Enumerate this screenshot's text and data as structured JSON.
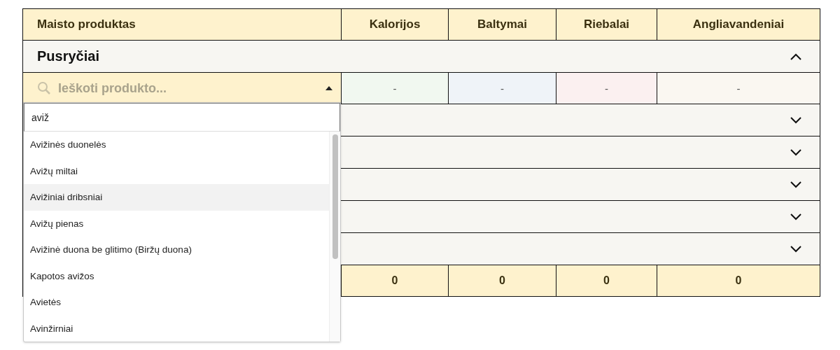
{
  "table": {
    "columns": [
      "Maisto produktas",
      "Kalorijos",
      "Baltymai",
      "Riebalai",
      "Angliavandeniai"
    ],
    "sections": [
      {
        "title": "Pusryčiai",
        "expanded": true,
        "search": {
          "placeholder": "Ieškoti produkto...",
          "open": true,
          "cells": [
            {
              "text": "-",
              "color": "#f1f8f0"
            },
            {
              "text": "-",
              "color": "#eff3f8"
            },
            {
              "text": "-",
              "color": "#fbf0f0"
            },
            {
              "text": "-",
              "color": "#faf7f1"
            }
          ]
        }
      },
      {
        "expanded": false
      },
      {
        "expanded": false
      },
      {
        "expanded": false
      },
      {
        "expanded": false
      },
      {
        "expanded": false
      }
    ],
    "totals": [
      "0",
      "0",
      "0",
      "0"
    ]
  },
  "dropdown": {
    "query": "aviž",
    "options": [
      {
        "label": "Avižinės duonelės",
        "selected": false
      },
      {
        "label": "Avižų miltai",
        "selected": false
      },
      {
        "label": "Avižiniai dribsniai",
        "selected": true
      },
      {
        "label": "Avižų pienas",
        "selected": false
      },
      {
        "label": "Avižinė duona be glitimo (Biržų duona)",
        "selected": false
      },
      {
        "label": "Kapotos avižos",
        "selected": false
      },
      {
        "label": "Avietės",
        "selected": false
      },
      {
        "label": "Avinžirniai",
        "selected": false
      }
    ]
  }
}
